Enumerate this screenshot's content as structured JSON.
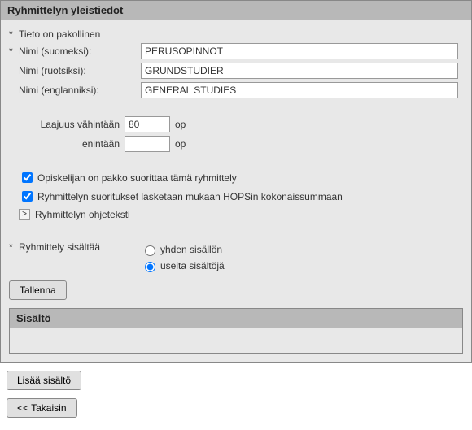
{
  "panel1": {
    "title": "Ryhmittelyn yleistiedot",
    "mandatory_note": "Tieto on pakollinen",
    "rows": {
      "name_fi_label": "Nimi (suomeksi):",
      "name_fi_value": "PERUSOPINNOT",
      "name_sv_label": "Nimi (ruotsiksi):",
      "name_sv_value": "GRUNDSTUDIER",
      "name_en_label": "Nimi (englanniksi):",
      "name_en_value": "GENERAL STUDIES",
      "extent_min_label": "Laajuus vähintään",
      "extent_min_value": "80",
      "extent_max_label": "enintään",
      "extent_max_value": "",
      "extent_unit": "op"
    },
    "checks": {
      "mandatory_group": "Opiskelijan on pakko suorittaa tämä ryhmittely",
      "include_sum": "Ryhmittelyn suoritukset lasketaan mukaan HOPSin kokonaissummaan"
    },
    "accordion": {
      "chevron": ">",
      "label": "Ryhmittelyn ohjeteksti"
    },
    "contains": {
      "label": "Ryhmittely sisältää",
      "opt_single": "yhden sisällön",
      "opt_multi": "useita sisältöjä"
    },
    "save_btn": "Tallenna"
  },
  "panel2": {
    "title": "Sisältö"
  },
  "buttons": {
    "add_content": "Lisää sisältö",
    "back": "<< Takaisin"
  }
}
